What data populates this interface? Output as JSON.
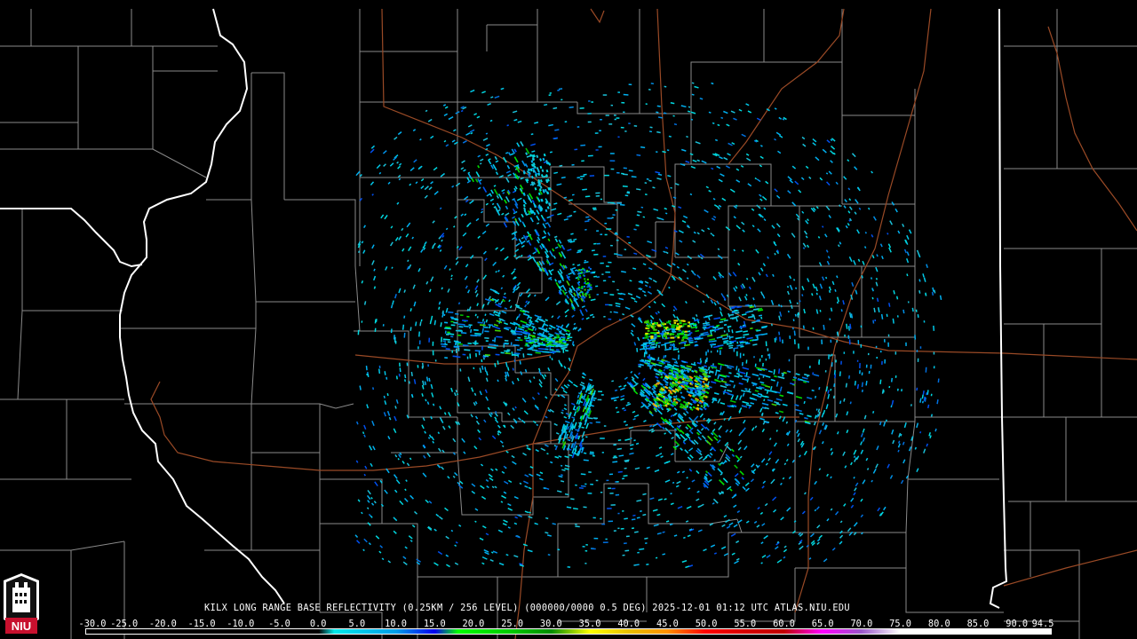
{
  "caption": "KILX LONG RANGE BASE REFLECTIVITY (0.25KM / 256 LEVEL) (000000/0000 0.5 DEG) 2025-12-01 01:12 UTC  ATLAS.NIU.EDU",
  "logo_text": "NIU",
  "colors": {
    "background": "#000000",
    "county_lines": "#8a8a8a",
    "state_lines": "#ffffff",
    "highways": "#9a4a26",
    "logo_red": "#c8102e"
  },
  "colorbar_ticks": [
    "-30.0",
    "-25.0",
    "-20.0",
    "-15.0",
    "-10.0",
    "-5.0",
    "0.0",
    "5.0",
    "10.0",
    "15.0",
    "20.0",
    "25.0",
    "30.0",
    "35.0",
    "40.0",
    "45.0",
    "50.0",
    "55.0",
    "60.0",
    "65.0",
    "70.0",
    "75.0",
    "80.0",
    "85.0",
    "90.0",
    "94.5"
  ],
  "colorbar_stops": [
    {
      "dbz": -30,
      "color": "#000000"
    },
    {
      "dbz": 0,
      "color": "#000000"
    },
    {
      "dbz": 2,
      "color": "#00e8e8"
    },
    {
      "dbz": 10,
      "color": "#009de8"
    },
    {
      "dbz": 15,
      "color": "#0000f0"
    },
    {
      "dbz": 18,
      "color": "#00ff00"
    },
    {
      "dbz": 25,
      "color": "#00c800"
    },
    {
      "dbz": 30,
      "color": "#008c00"
    },
    {
      "dbz": 35,
      "color": "#ffff00"
    },
    {
      "dbz": 40,
      "color": "#e7c000"
    },
    {
      "dbz": 45,
      "color": "#ff9000"
    },
    {
      "dbz": 50,
      "color": "#ff0000"
    },
    {
      "dbz": 55,
      "color": "#d60000"
    },
    {
      "dbz": 60,
      "color": "#c00000"
    },
    {
      "dbz": 65,
      "color": "#ff00ff"
    },
    {
      "dbz": 70,
      "color": "#9955c9"
    },
    {
      "dbz": 75,
      "color": "#ffffff"
    },
    {
      "dbz": 94.5,
      "color": "#ffffff"
    }
  ]
}
